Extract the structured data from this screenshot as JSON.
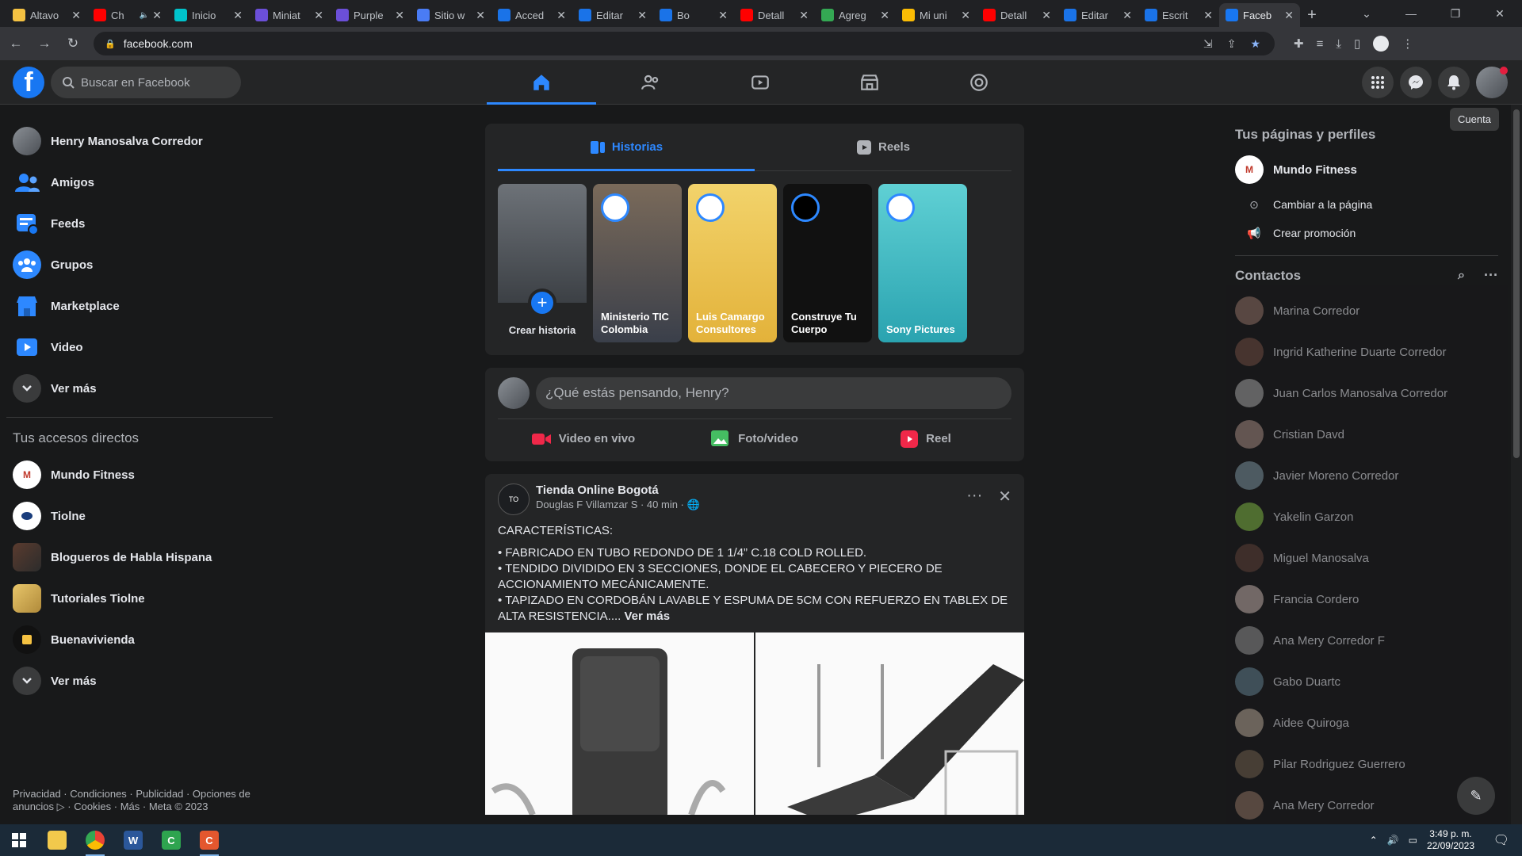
{
  "browser": {
    "tabs": [
      {
        "title": "Altavo",
        "icon": "cookie-icon",
        "color": "#f5c242"
      },
      {
        "title": "Ch",
        "icon": "youtube-icon",
        "color": "#ff0000",
        "muted": true
      },
      {
        "title": "Inicio",
        "icon": "canva-icon",
        "color": "#00c4cc"
      },
      {
        "title": "Miniat",
        "icon": "shield-icon",
        "color": "#6b4fd8"
      },
      {
        "title": "Purple",
        "icon": "shield-icon",
        "color": "#6b4fd8"
      },
      {
        "title": "Sitio w",
        "icon": "site-icon",
        "color": "#4a7cf5"
      },
      {
        "title": "Acced",
        "icon": "t-icon",
        "color": "#1a73e8"
      },
      {
        "title": "Editar",
        "icon": "t-icon",
        "color": "#1a73e8"
      },
      {
        "title": "Bo",
        "icon": "t-icon",
        "color": "#1a73e8"
      },
      {
        "title": "Detall",
        "icon": "youtube-icon",
        "color": "#ff0000"
      },
      {
        "title": "Agreg",
        "icon": "sheet-icon",
        "color": "#34a853"
      },
      {
        "title": "Mi uni",
        "icon": "drive-icon",
        "color": "#fbbc04"
      },
      {
        "title": "Detall",
        "icon": "youtube-icon",
        "color": "#ff0000"
      },
      {
        "title": "Editar",
        "icon": "t-icon",
        "color": "#1a73e8"
      },
      {
        "title": "Escrit",
        "icon": "t-icon",
        "color": "#1a73e8"
      },
      {
        "title": "Faceb",
        "icon": "facebook-icon",
        "color": "#1877f2",
        "active": true
      }
    ],
    "url": "facebook.com"
  },
  "header": {
    "search_placeholder": "Buscar en Facebook",
    "tooltip": "Cuenta",
    "accent": "#2d88ff"
  },
  "left": {
    "items": [
      {
        "label": "Henry Manosalva Corredor",
        "icon": "avatar"
      },
      {
        "label": "Amigos",
        "icon": "friends-icon"
      },
      {
        "label": "Feeds",
        "icon": "feeds-icon"
      },
      {
        "label": "Grupos",
        "icon": "groups-icon"
      },
      {
        "label": "Marketplace",
        "icon": "marketplace-icon"
      },
      {
        "label": "Video",
        "icon": "video-icon"
      },
      {
        "label": "Ver más",
        "icon": "chevron-down-icon"
      }
    ],
    "shortcuts_title": "Tus accesos directos",
    "shortcuts": [
      {
        "label": "Mundo Fitness"
      },
      {
        "label": "Tiolne"
      },
      {
        "label": "Blogueros de Habla Hispana"
      },
      {
        "label": "Tutoriales Tiolne"
      },
      {
        "label": "Buenavivienda"
      },
      {
        "label": "Ver más"
      }
    ],
    "footer": "Privacidad · Condiciones · Publicidad · Opciones de anuncios ▷ · Cookies · Más · Meta © 2023"
  },
  "stories": {
    "tabs": [
      "Historias",
      "Reels"
    ],
    "items": [
      {
        "name": "Crear historia"
      },
      {
        "name": "Ministerio TIC Colombia"
      },
      {
        "name": "Luis Camargo Consultores"
      },
      {
        "name": "Construye Tu Cuerpo"
      },
      {
        "name": "Sony Pictures"
      }
    ]
  },
  "composer": {
    "placeholder": "¿Qué estás pensando, Henry?",
    "actions": [
      "Video en vivo",
      "Foto/video",
      "Reel"
    ]
  },
  "post": {
    "page": "Tienda Online Bogotá",
    "meta": "Douglas F Villamzar S · 40 min · ",
    "lines": [
      "CARACTERÍSTICAS:",
      "• FABRICADO EN TUBO REDONDO DE 1 1/4” C.18 COLD ROLLED.",
      "• TENDIDO DIVIDIDO EN 3 SECCIONES, DONDE EL CABECERO Y PIECERO DE ACCIONAMIENTO MECÁNICAMENTE.",
      "• TAPIZADO EN CORDOBÁN LAVABLE Y ESPUMA DE 5CM CON REFUERZO EN TABLEX DE ALTA RESISTENCIA...."
    ],
    "see_more": "Ver más"
  },
  "right": {
    "pages_title": "Tus páginas y perfiles",
    "page_name": "Mundo Fitness",
    "page_actions": [
      "Cambiar a la página",
      "Crear promoción"
    ],
    "contacts_title": "Contactos",
    "contacts": [
      "Marina Corredor",
      "Ingrid Katherine Duarte Corredor",
      "Juan Carlos Manosalva Corredor",
      "Cristian Davd",
      "Javier Moreno Corredor",
      "Yakelin Garzon",
      "Miguel Manosalva",
      "Francia Cordero",
      "Ana Mery Corredor F",
      "Gabo Duartc",
      "Aidee Quiroga",
      "Pilar Rodriguez Guerrero",
      "Ana Mery Corredor"
    ]
  },
  "taskbar": {
    "time": "3:49 p. m.",
    "date": "22/09/2023"
  }
}
